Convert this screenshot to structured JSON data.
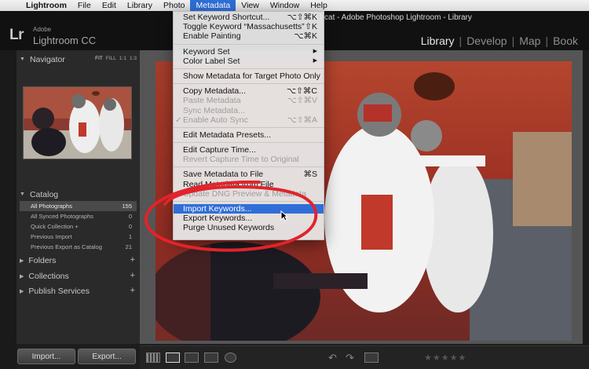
{
  "menubar": {
    "apple_icon": "apple-icon",
    "items": [
      "Lightroom",
      "File",
      "Edit",
      "Library",
      "Photo",
      "Metadata",
      "View",
      "Window",
      "Help"
    ],
    "active": "Metadata"
  },
  "window": {
    "title": "...nt.lrcat - Adobe Photoshop Lightroom - Library"
  },
  "identity": {
    "logo": "Lr",
    "adobe": "Adobe",
    "product": "Lightroom CC"
  },
  "modules": {
    "library": "Library",
    "develop": "Develop",
    "map": "Map",
    "book": "Book"
  },
  "navigator": {
    "title": "Navigator",
    "fit": "FIT",
    "fill": "FILL",
    "one": "1:1",
    "three": "1:3"
  },
  "catalog": {
    "title": "Catalog",
    "rows": [
      {
        "label": "All Photographs",
        "count": "155"
      },
      {
        "label": "All Synced Photographs",
        "count": "0"
      },
      {
        "label": "Quick Collection +",
        "count": "0"
      },
      {
        "label": "Previous Import",
        "count": "1"
      },
      {
        "label": "Previous Export as Catalog",
        "count": "21"
      }
    ]
  },
  "folders": {
    "title": "Folders",
    "plus": "+"
  },
  "collections": {
    "title": "Collections",
    "plus": "+"
  },
  "publish": {
    "title": "Publish Services",
    "plus": "+"
  },
  "buttons": {
    "import": "Import...",
    "export": "Export..."
  },
  "menu": {
    "set_shortcut": {
      "label": "Set Keyword Shortcut...",
      "sc": "⌥⇧⌘K"
    },
    "toggle_keyword": {
      "label": "Toggle Keyword “Massachusetts”",
      "sc": "⇧K"
    },
    "enable_painting": {
      "label": "Enable Painting",
      "sc": "⌥⌘K"
    },
    "keyword_set": {
      "label": "Keyword Set"
    },
    "color_label_set": {
      "label": "Color Label Set"
    },
    "show_metadata": {
      "label": "Show Metadata for Target Photo Only"
    },
    "copy_metadata": {
      "label": "Copy Metadata...",
      "sc": "⌥⇧⌘C"
    },
    "paste_metadata": {
      "label": "Paste Metadata",
      "sc": "⌥⇧⌘V"
    },
    "sync_metadata": {
      "label": "Sync Metadata..."
    },
    "enable_auto_sync": {
      "label": "Enable Auto Sync",
      "sc": "⌥⇧⌘A",
      "check": "✓"
    },
    "edit_presets": {
      "label": "Edit Metadata Presets..."
    },
    "edit_capture": {
      "label": "Edit Capture Time..."
    },
    "revert_capture": {
      "label": "Revert Capture Time to Original"
    },
    "save_metadata": {
      "label": "Save Metadata to File",
      "sc": "⌘S"
    },
    "read_metadata": {
      "label": "Read Metadata from File"
    },
    "update_dng": {
      "label": "Update DNG Preview & Metadata"
    },
    "import_keywords": {
      "label": "Import Keywords..."
    },
    "export_keywords": {
      "label": "Export Keywords..."
    },
    "purge_keywords": {
      "label": "Purge Unused Keywords"
    }
  },
  "toolbar": {
    "grid_icon": "grid-view-icon",
    "loupe_icon": "loupe-view-icon",
    "compare_icon": "compare-view-icon",
    "survey_icon": "survey-view-icon",
    "people_icon": "people-view-icon",
    "stars": "★★★★★"
  },
  "colors": {
    "accent": "#2f6ed8",
    "annotation": "#e0242b"
  }
}
